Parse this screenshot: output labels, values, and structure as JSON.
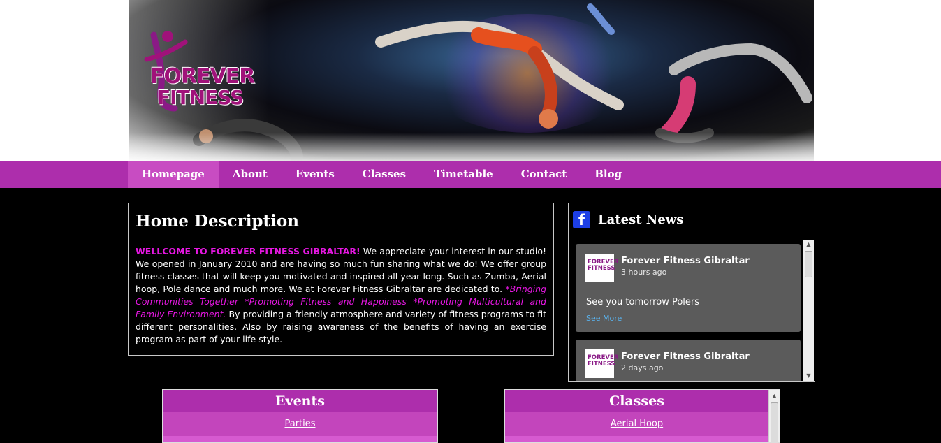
{
  "banner": {
    "logo_text_line1": "FOREVER",
    "logo_text_line2": "FITNESS"
  },
  "nav": {
    "items": [
      "Homepage",
      "About",
      "Events",
      "Classes",
      "Timetable",
      "Contact",
      "Blog"
    ],
    "active": "Homepage"
  },
  "home": {
    "title": "Home Description",
    "highlight": "WELLCOME TO FOREVER FITNESS GIBRALTAR!",
    "text1": " We appreciate your interest in our studio!  We opened in January 2010 and are having so much fun sharing what we do!  We offer group fitness classes that will keep you motivated and inspired all year long. Such as Zumba, Aerial hoop, Pole dance and much more. We at Forever Fitness Gibraltar are dedicated to. ",
    "italic": "*Bringing Communities Together *Promoting Fitness and Happiness *Promoting Multicultural and Family Environment.",
    "text2": " By providing a friendly atmosphere and variety of fitness programs to fit different personalities. Also by raising awareness of the benefits of having an exercise program as part of your life style."
  },
  "news": {
    "title": "Latest News",
    "icon": "facebook-icon",
    "posts": [
      {
        "name": "Forever Fitness Gibraltar",
        "time": "3 hours ago",
        "text": "See you tomorrow Polers",
        "more": "See More",
        "avatar_text": "FOREVER FITNESS"
      },
      {
        "name": "Forever Fitness Gibraltar",
        "time": "2 days ago",
        "avatar_text": "FOREVER FITNESS"
      }
    ]
  },
  "panels": {
    "events": {
      "title": "Events",
      "first_item": "Parties"
    },
    "classes": {
      "title": "Classes",
      "first_item": "Aerial Hoop"
    }
  },
  "colors": {
    "nav_bg": "#ad2eac",
    "nav_active": "#c84cc2",
    "magenta_text": "#e617e2",
    "facebook_blue": "#1d3fe6",
    "post_bg": "#5b5b5b"
  }
}
